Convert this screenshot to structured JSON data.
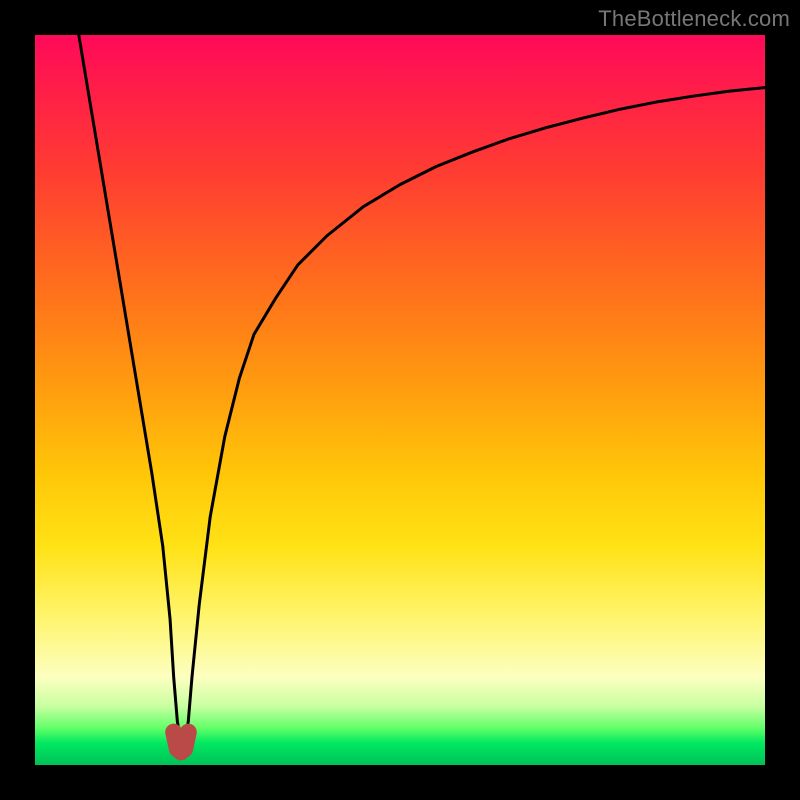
{
  "watermark": "TheBottleneck.com",
  "chart_data": {
    "type": "line",
    "title": "",
    "xlabel": "",
    "ylabel": "",
    "xlim": [
      0,
      100
    ],
    "ylim": [
      0,
      100
    ],
    "grid": false,
    "legend": false,
    "series": [
      {
        "name": "bottleneck-curve",
        "color": "#000000",
        "x": [
          6,
          8,
          10,
          12,
          14,
          16,
          17.5,
          18.5,
          19,
          19.5,
          20,
          20.5,
          21,
          21.5,
          22.5,
          24,
          26,
          28,
          30,
          33,
          36,
          40,
          45,
          50,
          55,
          60,
          65,
          70,
          75,
          80,
          85,
          90,
          95,
          100
        ],
        "y": [
          100,
          88,
          76,
          64,
          52,
          40,
          30,
          20,
          12,
          6,
          3,
          3,
          6,
          12,
          22,
          34,
          45,
          53,
          59,
          64,
          68.5,
          72.5,
          76.5,
          79.5,
          82,
          84,
          85.8,
          87.3,
          88.6,
          89.8,
          90.8,
          91.6,
          92.3,
          92.8
        ]
      },
      {
        "name": "min-marker",
        "color": "#b94a48",
        "shape": "u",
        "x": [
          19,
          19.5,
          20,
          20.5,
          21
        ],
        "y": [
          4.5,
          2.2,
          1.8,
          2.2,
          4.5
        ]
      }
    ],
    "background_gradient": {
      "direction": "top-to-bottom",
      "stops": [
        {
          "pos": 0.0,
          "color": "#ff0a5a"
        },
        {
          "pos": 0.5,
          "color": "#ffa20e"
        },
        {
          "pos": 0.8,
          "color": "#fff570"
        },
        {
          "pos": 0.95,
          "color": "#5fff67"
        },
        {
          "pos": 1.0,
          "color": "#00c258"
        }
      ]
    }
  }
}
